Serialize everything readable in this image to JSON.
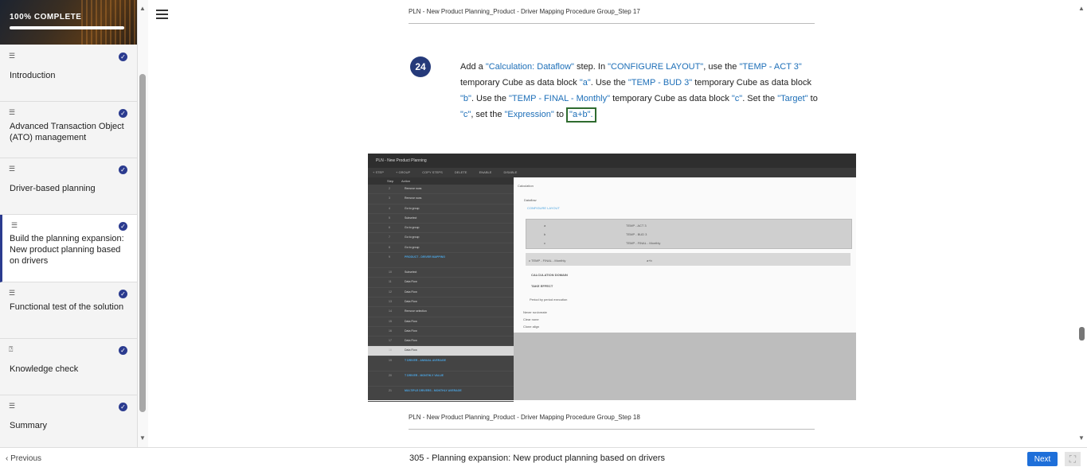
{
  "sidebar": {
    "progress_label": "100% COMPLETE",
    "progress": 1.0,
    "lessons": [
      {
        "title": "Introduction",
        "icon": "text-lines-icon",
        "complete": true
      },
      {
        "title": "Advanced Transaction Object (ATO) management",
        "icon": "text-lines-icon",
        "complete": true
      },
      {
        "title": "Driver-based planning",
        "icon": "text-lines-icon",
        "complete": true
      },
      {
        "title": "Build the planning expansion: New product planning based on drivers",
        "icon": "text-lines-icon",
        "complete": true,
        "active": true
      },
      {
        "title": "Functional test of the solution",
        "icon": "text-lines-icon",
        "complete": true
      },
      {
        "title": "Knowledge check",
        "icon": "quiz-icon",
        "complete": true
      },
      {
        "title": "Summary",
        "icon": "text-lines-icon",
        "complete": true
      }
    ]
  },
  "content": {
    "caption_top": "PLN - New Product Planning_Product - Driver Mapping Procedure Group_Step 17",
    "step_number": "24",
    "step_parts": [
      {
        "t": "Add a ",
        "h": false
      },
      {
        "t": "\"Calculation: Dataflow\"",
        "h": true
      },
      {
        "t": " step. In ",
        "h": false
      },
      {
        "t": "\"CONFIGURE LAYOUT\"",
        "h": true
      },
      {
        "t": ", use the ",
        "h": false
      },
      {
        "t": "\"TEMP - ACT 3\"",
        "h": true
      },
      {
        "t": " temporary Cube as data block ",
        "h": false
      },
      {
        "t": "\"a\"",
        "h": true
      },
      {
        "t": ". Use the ",
        "h": false
      },
      {
        "t": "\"TEMP - BUD 3\"",
        "h": true
      },
      {
        "t": " temporary Cube as data block ",
        "h": false
      },
      {
        "t": "\"b\"",
        "h": true
      },
      {
        "t": ". Use the ",
        "h": false
      },
      {
        "t": "\"TEMP - FINAL - Monthly\"",
        "h": true
      },
      {
        "t": " temporary Cube as data block ",
        "h": false
      },
      {
        "t": "\"c\"",
        "h": true
      },
      {
        "t": ". Set the ",
        "h": false
      },
      {
        "t": "\"Target\"",
        "h": true
      },
      {
        "t": " to ",
        "h": false
      },
      {
        "t": "\"c\"",
        "h": true
      },
      {
        "t": ", set the ",
        "h": false
      },
      {
        "t": "\"Expression\"",
        "h": true
      },
      {
        "t": " to",
        "h": false
      }
    ],
    "step_boxed": "\"a+b\".",
    "caption_bottom": "PLN - New Product Planning_Product - Driver Mapping Procedure Group_Step 18",
    "screenshot": {
      "title": "PLN - New Product Planning",
      "toolbar": [
        "+ STEP",
        "+ GROUP",
        "COPY STEPS",
        "DELETE",
        "ENABLE",
        "DISABLE"
      ],
      "grid_header": [
        "Step",
        "Action"
      ],
      "rows": [
        {
          "n": "2",
          "a": "Remove rows"
        },
        {
          "n": "3",
          "a": "Remove rows"
        },
        {
          "n": "4",
          "a": "Go to group"
        },
        {
          "n": "5",
          "a": "Subselect"
        },
        {
          "n": "6",
          "a": "Go to group"
        },
        {
          "n": "7",
          "a": "Go to group"
        },
        {
          "n": "8",
          "a": "Go to group"
        },
        {
          "n": "9",
          "a": "PRODUCT - DRIVER MAPPING",
          "group": true
        },
        {
          "n": "10",
          "a": "Subselect"
        },
        {
          "n": "11",
          "a": "Data Flow"
        },
        {
          "n": "12",
          "a": "Data Flow"
        },
        {
          "n": "13",
          "a": "Data Flow"
        },
        {
          "n": "14",
          "a": "Remove selection"
        },
        {
          "n": "15",
          "a": "Data Flow"
        },
        {
          "n": "16",
          "a": "Data Flow"
        },
        {
          "n": "17",
          "a": "Data Flow"
        },
        {
          "n": "18",
          "a": "Data Flow",
          "selected": true
        },
        {
          "n": "19",
          "a": "T DRIVER - ANNUAL AVERAGE",
          "group": true
        },
        {
          "n": "20",
          "a": "T DRIVER - MONTHLY VALUE",
          "group": true
        },
        {
          "n": "21",
          "a": "MULTIPLE DRIVERS - MONTHLY AVERAGE",
          "group": true
        }
      ],
      "panel": {
        "step_type": "Calculation",
        "mode": "Dataflow",
        "configure_button": "CONFIGURE LAYOUT",
        "refs": [
          "TEMP - ACT 3",
          "TEMP - BUD 3",
          "TEMP - FINAL - Monthly"
        ],
        "ref_keys": [
          "a",
          "b",
          "c"
        ],
        "target": "c  TEMP - FINAL - Monthly",
        "expression": "a+b",
        "calc_domain": "CALCULATION DOMAIN",
        "take_effect": "TAKE EFFECT",
        "options": [
          "Period by period execution",
          "Never run/create",
          "Clear none",
          "Clone align"
        ]
      }
    }
  },
  "footer": {
    "prev_label": "Previous",
    "title": "305 - Planning expansion: New product planning based on drivers",
    "next_label": "Next"
  },
  "colors": {
    "accent": "#253a7a",
    "highlight": "#1d6fb8",
    "next_button": "#1e6fd9",
    "box_outline": "#2f6b2f"
  }
}
